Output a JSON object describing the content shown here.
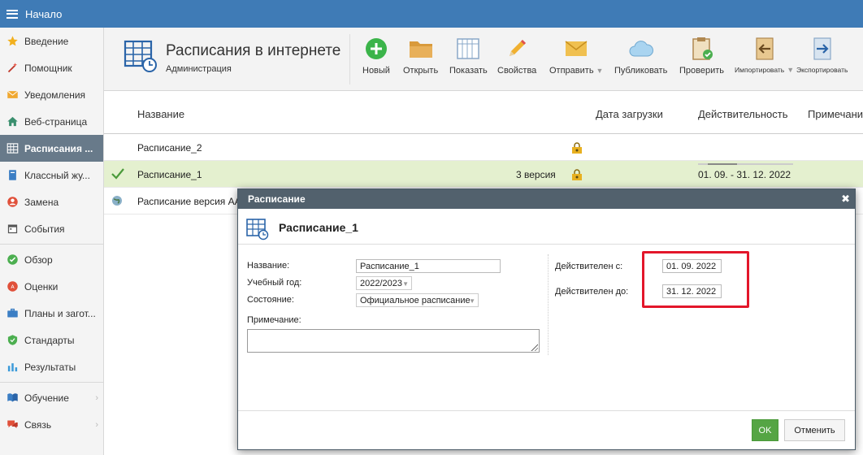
{
  "topbar": {
    "home_label": "Начало"
  },
  "sidebar": {
    "items": [
      {
        "label": "Введение",
        "icon": "star-icon"
      },
      {
        "label": "Помощник",
        "icon": "magic-wand-icon"
      },
      {
        "label": "Уведомления",
        "icon": "envelope-icon"
      },
      {
        "label": "Веб-страница",
        "icon": "house-icon"
      },
      {
        "label": "Расписания ...",
        "icon": "timetable-icon"
      },
      {
        "label": "Классный жу...",
        "icon": "journal-icon"
      },
      {
        "label": "Замена",
        "icon": "person-swap-icon"
      },
      {
        "label": "События",
        "icon": "calendar-icon"
      },
      {
        "label": "Обзор",
        "icon": "check-circle-icon"
      },
      {
        "label": "Оценки",
        "icon": "grades-icon"
      },
      {
        "label": "Планы и загот...",
        "icon": "briefcase-icon"
      },
      {
        "label": "Стандарты",
        "icon": "shield-check-icon"
      },
      {
        "label": "Результаты",
        "icon": "bar-chart-icon"
      },
      {
        "label": "Обучение",
        "icon": "book-icon"
      },
      {
        "label": "Связь",
        "icon": "chat-icon"
      }
    ]
  },
  "header": {
    "title": "Расписания в интернете",
    "subtitle": "Администрация",
    "toolbar": {
      "new": "Новый",
      "open": "Открыть",
      "show": "Показать",
      "properties": "Свойства",
      "send": "Отправить",
      "publish": "Публиковать",
      "check": "Проверить",
      "import": "Импортировать",
      "export": "Экспортировать"
    }
  },
  "table": {
    "columns": [
      "Название",
      "Дата загрузки",
      "Действительность",
      "Примечание"
    ],
    "rows": [
      {
        "name": "Расписание_2",
        "version": "",
        "validity": ""
      },
      {
        "name": "Расписание_1",
        "version": "3 версия",
        "validity": "01. 09. - 31. 12. 2022"
      },
      {
        "name": "Расписание версия ААА",
        "version": "",
        "validity": ""
      }
    ]
  },
  "dialog": {
    "bar_title": "Расписание",
    "title": "Расписание_1",
    "fields": {
      "name_label": "Название:",
      "name_value": "Расписание_1",
      "year_label": "Учебный год:",
      "year_value": "2022/2023",
      "state_label": "Состояние:",
      "state_value": "Официальное расписание",
      "note_label": "Примечание:",
      "valid_from_label": "Действителен с:",
      "valid_from_value": "01. 09. 2022",
      "valid_to_label": "Действителен до:",
      "valid_to_value": "31. 12. 2022"
    },
    "ok_label": "OK",
    "cancel_label": "Отменить"
  },
  "colors": {
    "topbar": "#3f7bb6",
    "sidebar_active": "#687a8a",
    "selected_row": "#e4f0cf",
    "ok_button": "#55a544",
    "highlight_border": "#e3162a"
  }
}
